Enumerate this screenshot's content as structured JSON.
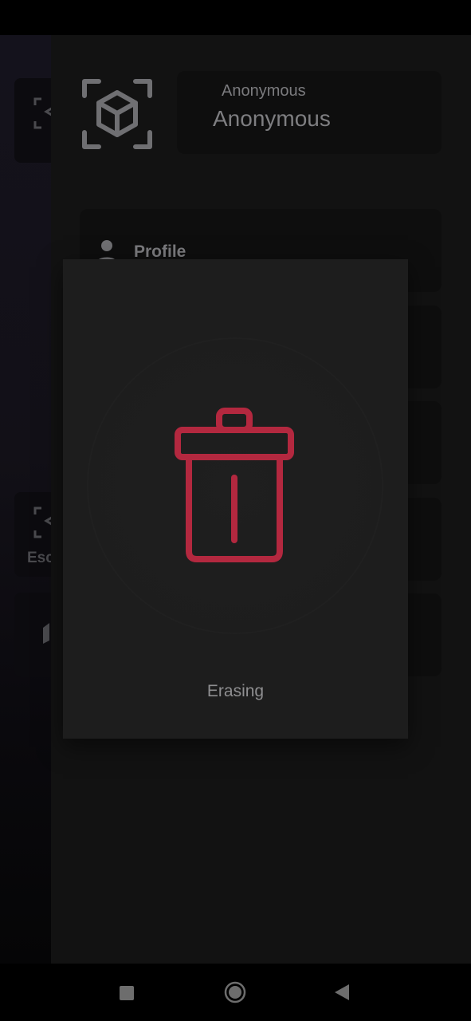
{
  "background_app": {
    "cards": [
      {
        "label": ""
      },
      {
        "label": "Esc"
      },
      {
        "label": ""
      }
    ]
  },
  "drawer": {
    "user": {
      "small_name": "Anonymous",
      "large_name": "Anonymous"
    },
    "menu": [
      {
        "label": "Profile",
        "icon": "person-icon"
      },
      {
        "label": ""
      },
      {
        "label": ""
      },
      {
        "label": ""
      },
      {
        "label": ""
      }
    ]
  },
  "dialog": {
    "status_text": "Erasing",
    "icon": "trash-icon",
    "accent_color": "#b3283f"
  },
  "navigation": {
    "recents": "square-icon",
    "home": "circle-icon",
    "back": "triangle-back-icon"
  }
}
